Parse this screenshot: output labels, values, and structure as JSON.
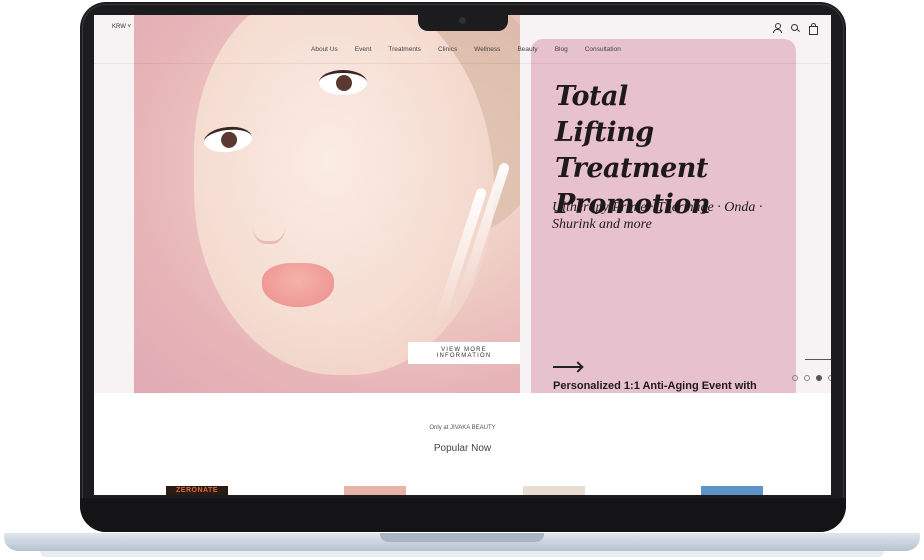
{
  "header": {
    "currency": "KRW ˅",
    "nav": [
      {
        "label": "About Us"
      },
      {
        "label": "Event"
      },
      {
        "label": "Treatments"
      },
      {
        "label": "Clinics"
      },
      {
        "label": "Wellness"
      },
      {
        "label": "Beauty"
      },
      {
        "label": "Blog"
      },
      {
        "label": "Consultation"
      }
    ],
    "icons": [
      "user-icon",
      "search-icon",
      "bag-icon"
    ]
  },
  "hero": {
    "title_lines": [
      "Total",
      "Lifting Treatment",
      "Promotion"
    ],
    "subtitle": "Ultherapy Prime · Thermage · Onda · Shurink and more",
    "cta": "VIEW MORE INFORMATION",
    "event_text": "Personalized 1:1 Anti-Aging Event with",
    "slide_dots": 4,
    "active_slide": 3,
    "panel_color": "#e8c1cf"
  },
  "popular": {
    "tag": "Only at JIVAKA BEAUTY",
    "title": "Popular Now",
    "first_thumb_text": "ZERONATE"
  }
}
